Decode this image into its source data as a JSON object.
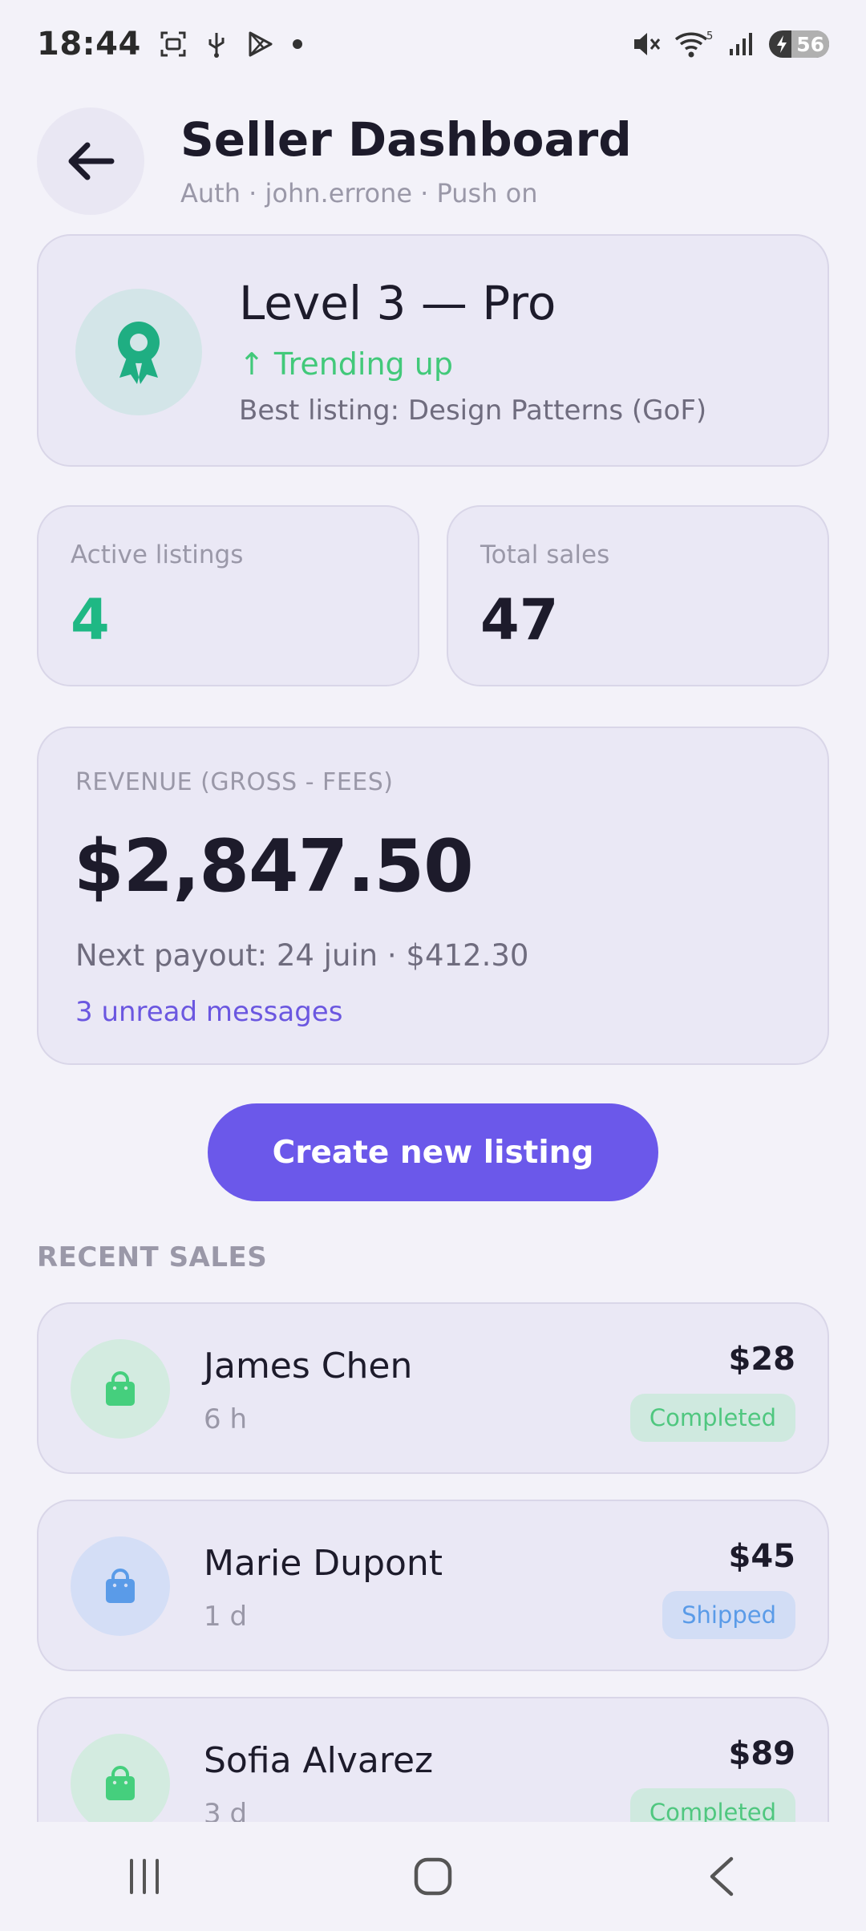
{
  "status_bar": {
    "time": "18:44",
    "left_icons": [
      "screenshot-icon",
      "usb-icon",
      "play-store-icon",
      "dot-icon"
    ],
    "right_icons": [
      "mute-icon",
      "wifi-icon",
      "signal-icon"
    ],
    "battery_level": "56",
    "wifi_label": "5"
  },
  "header": {
    "back_icon": "arrow-left-icon",
    "title": "Seller Dashboard",
    "subtitle": "Auth · john.errone · Push on"
  },
  "level": {
    "icon": "award-icon",
    "title": "Level 3 — Pro",
    "trend": "↑ Trending up",
    "best_listing": "Best listing: Design Patterns (GoF)"
  },
  "stats": {
    "active_label": "Active listings",
    "active_value": "4",
    "sales_label": "Total sales",
    "sales_value": "47"
  },
  "revenue": {
    "label": "REVENUE (GROSS - FEES)",
    "amount": "$2,847.50",
    "payout": "Next payout: 24 juin · $412.30",
    "messages": "3 unread messages"
  },
  "cta": {
    "label": "Create new listing"
  },
  "recent_sales": {
    "title": "RECENT SALES",
    "items": [
      {
        "name": "James Chen",
        "time": "6 h",
        "amount": "$28",
        "status": "Completed",
        "icon": "shopping-bag-icon"
      },
      {
        "name": "Marie Dupont",
        "time": "1 d",
        "amount": "$45",
        "status": "Shipped",
        "icon": "shopping-bag-icon"
      },
      {
        "name": "Sofia Alvarez",
        "time": "3 d",
        "amount": "$89",
        "status": "Completed",
        "icon": "shopping-bag-icon"
      }
    ]
  },
  "colors": {
    "accent": "#6b58ea",
    "green": "#1fb884",
    "completed_bg": "#cfe9df",
    "completed_text": "#4fc77f",
    "shipped_bg": "#d2ddf5",
    "shipped_text": "#5a9be8",
    "green_avatar_bg": "#d3ebe0",
    "blue_avatar_bg": "#d4def6"
  },
  "nav": {
    "recents_icon": "recents-icon",
    "home_icon": "home-icon",
    "back_icon": "nav-back-icon"
  }
}
